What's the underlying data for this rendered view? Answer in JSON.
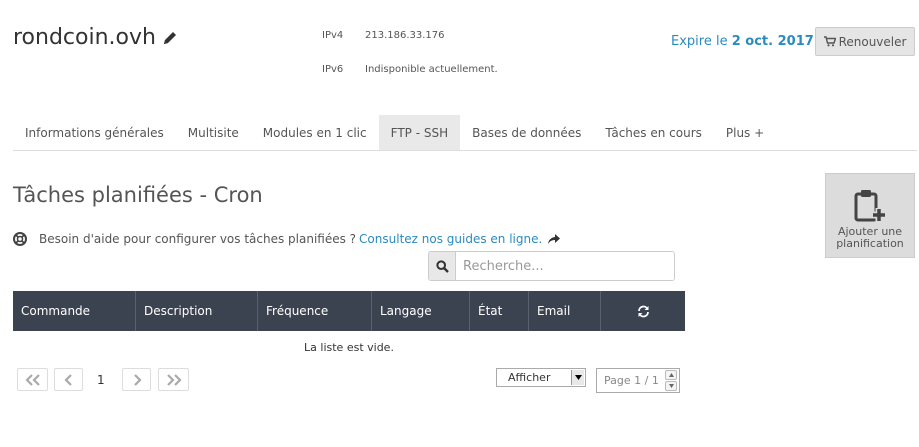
{
  "header": {
    "domain": "rondcoin.ovh",
    "ipv4_label": "IPv4",
    "ipv4_value": "213.186.33.176",
    "ipv6_label": "IPv6",
    "ipv6_value": "Indisponible actuellement.",
    "expire_prefix": "Expire le",
    "expire_date": "2 oct. 2017",
    "renew_label": "Renouveler"
  },
  "tabs": [
    {
      "label": "Informations générales",
      "active": false
    },
    {
      "label": "Multisite",
      "active": false
    },
    {
      "label": "Modules en 1 clic",
      "active": false
    },
    {
      "label": "FTP - SSH",
      "active": true
    },
    {
      "label": "Bases de données",
      "active": false
    },
    {
      "label": "Tâches en cours",
      "active": false
    },
    {
      "label": "Plus +",
      "active": false
    }
  ],
  "section": {
    "title": "Tâches planifiées - Cron",
    "help_text": "Besoin d'aide pour configurer vos tâches planifiées ?",
    "help_link": "Consultez nos guides en ligne.",
    "add_label_line1": "Ajouter une",
    "add_label_line2": "planification"
  },
  "search": {
    "placeholder": "Recherche..."
  },
  "table": {
    "columns": [
      "Commande",
      "Description",
      "Fréquence",
      "Langage",
      "État",
      "Email"
    ],
    "empty_text": "La liste est vide."
  },
  "pagination": {
    "current_page": "1",
    "show_label": "Afficher",
    "page_placeholder": "Page 1 / 1"
  },
  "colors": {
    "link": "#2a8bbf",
    "table_header": "#3c4350",
    "active_tab": "#e9e9e9"
  }
}
